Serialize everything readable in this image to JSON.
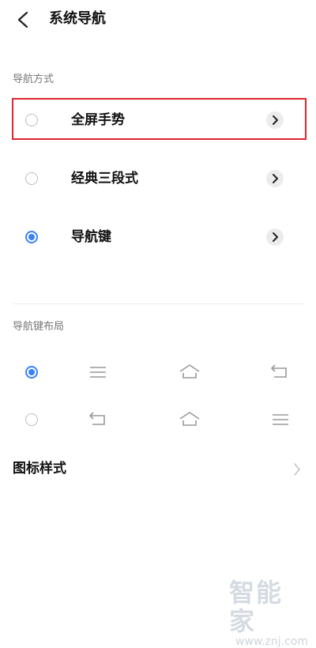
{
  "header": {
    "title": "系统导航",
    "back_icon": "chevron-left-icon"
  },
  "nav_method": {
    "section_title": "导航方式",
    "options": [
      {
        "label": "全屏手势",
        "selected": false,
        "highlighted": true
      },
      {
        "label": "经典三段式",
        "selected": false,
        "highlighted": false
      },
      {
        "label": "导航键",
        "selected": true,
        "highlighted": false
      }
    ]
  },
  "nav_key_layout": {
    "section_title": "导航键布局",
    "options": [
      {
        "selected": true,
        "icons": [
          "menu-icon",
          "home-icon",
          "back-icon"
        ]
      },
      {
        "selected": false,
        "icons": [
          "back-icon",
          "home-icon",
          "menu-icon"
        ]
      }
    ]
  },
  "icon_style": {
    "label": "图标样式"
  },
  "watermark": {
    "brand": "智能家",
    "url": "www.znj.com"
  },
  "colors": {
    "accent": "#3b82f6",
    "highlight": "#e0252a",
    "muted": "#777777"
  }
}
